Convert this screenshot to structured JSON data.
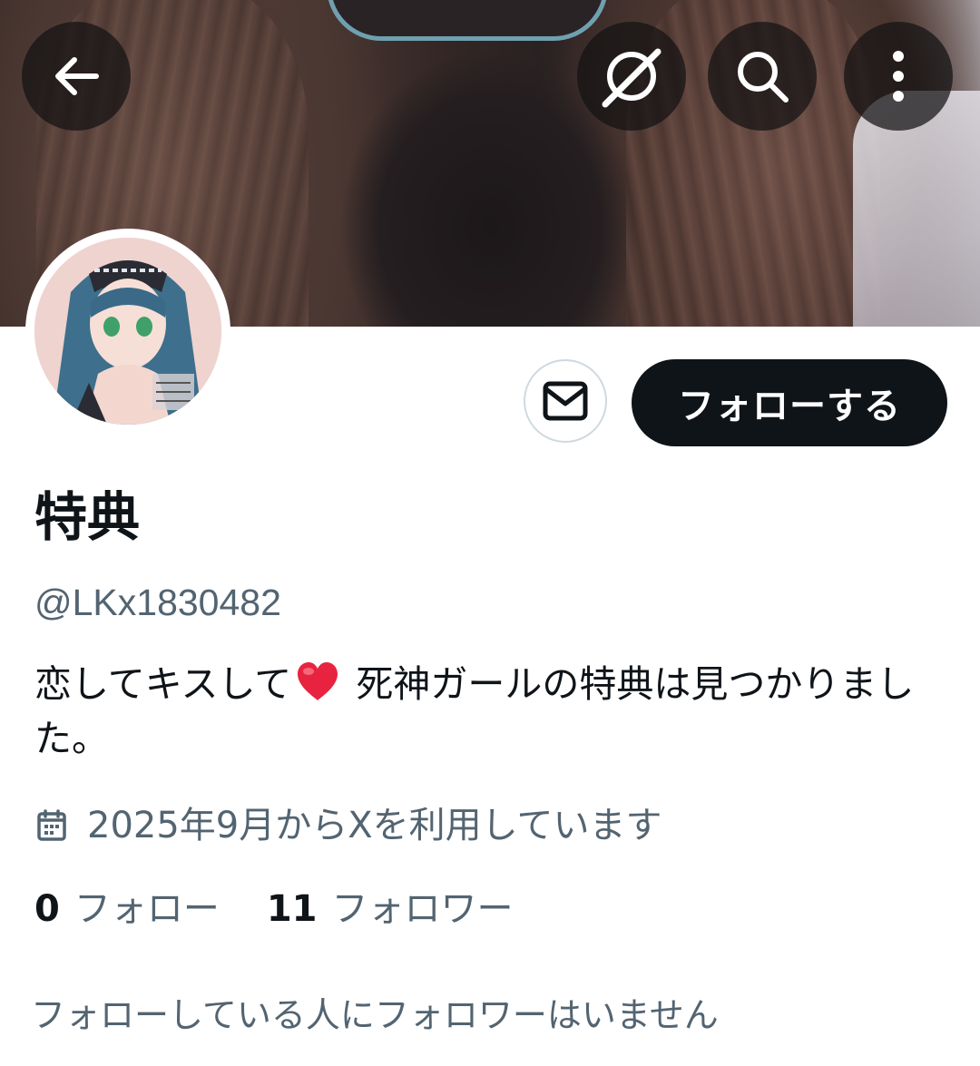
{
  "header": {
    "back_icon": "arrow-left-icon",
    "grok_icon": "grok-icon",
    "search_icon": "search-icon",
    "more_icon": "more-vertical-icon"
  },
  "profile": {
    "display_name": "特典",
    "handle": "@LKx1830482",
    "bio_before_emoji": "恋してキスして",
    "bio_emoji": "heart",
    "bio_after_emoji": " 死神ガールの特典は見つかりました。",
    "joined": "2025年9月からXを利用しています",
    "following_count": "0",
    "following_label": "フォロー",
    "followers_count": "11",
    "followers_label": "フォロワー",
    "mutual_note": "フォローしている人にフォロワーはいません"
  },
  "actions": {
    "message_icon": "envelope-icon",
    "follow_label": "フォローする"
  },
  "colors": {
    "primary_text": "#0f1419",
    "secondary_text": "#536471",
    "follow_bg": "#0f1419",
    "border": "#cfd9de",
    "heart": "#e8233f"
  }
}
